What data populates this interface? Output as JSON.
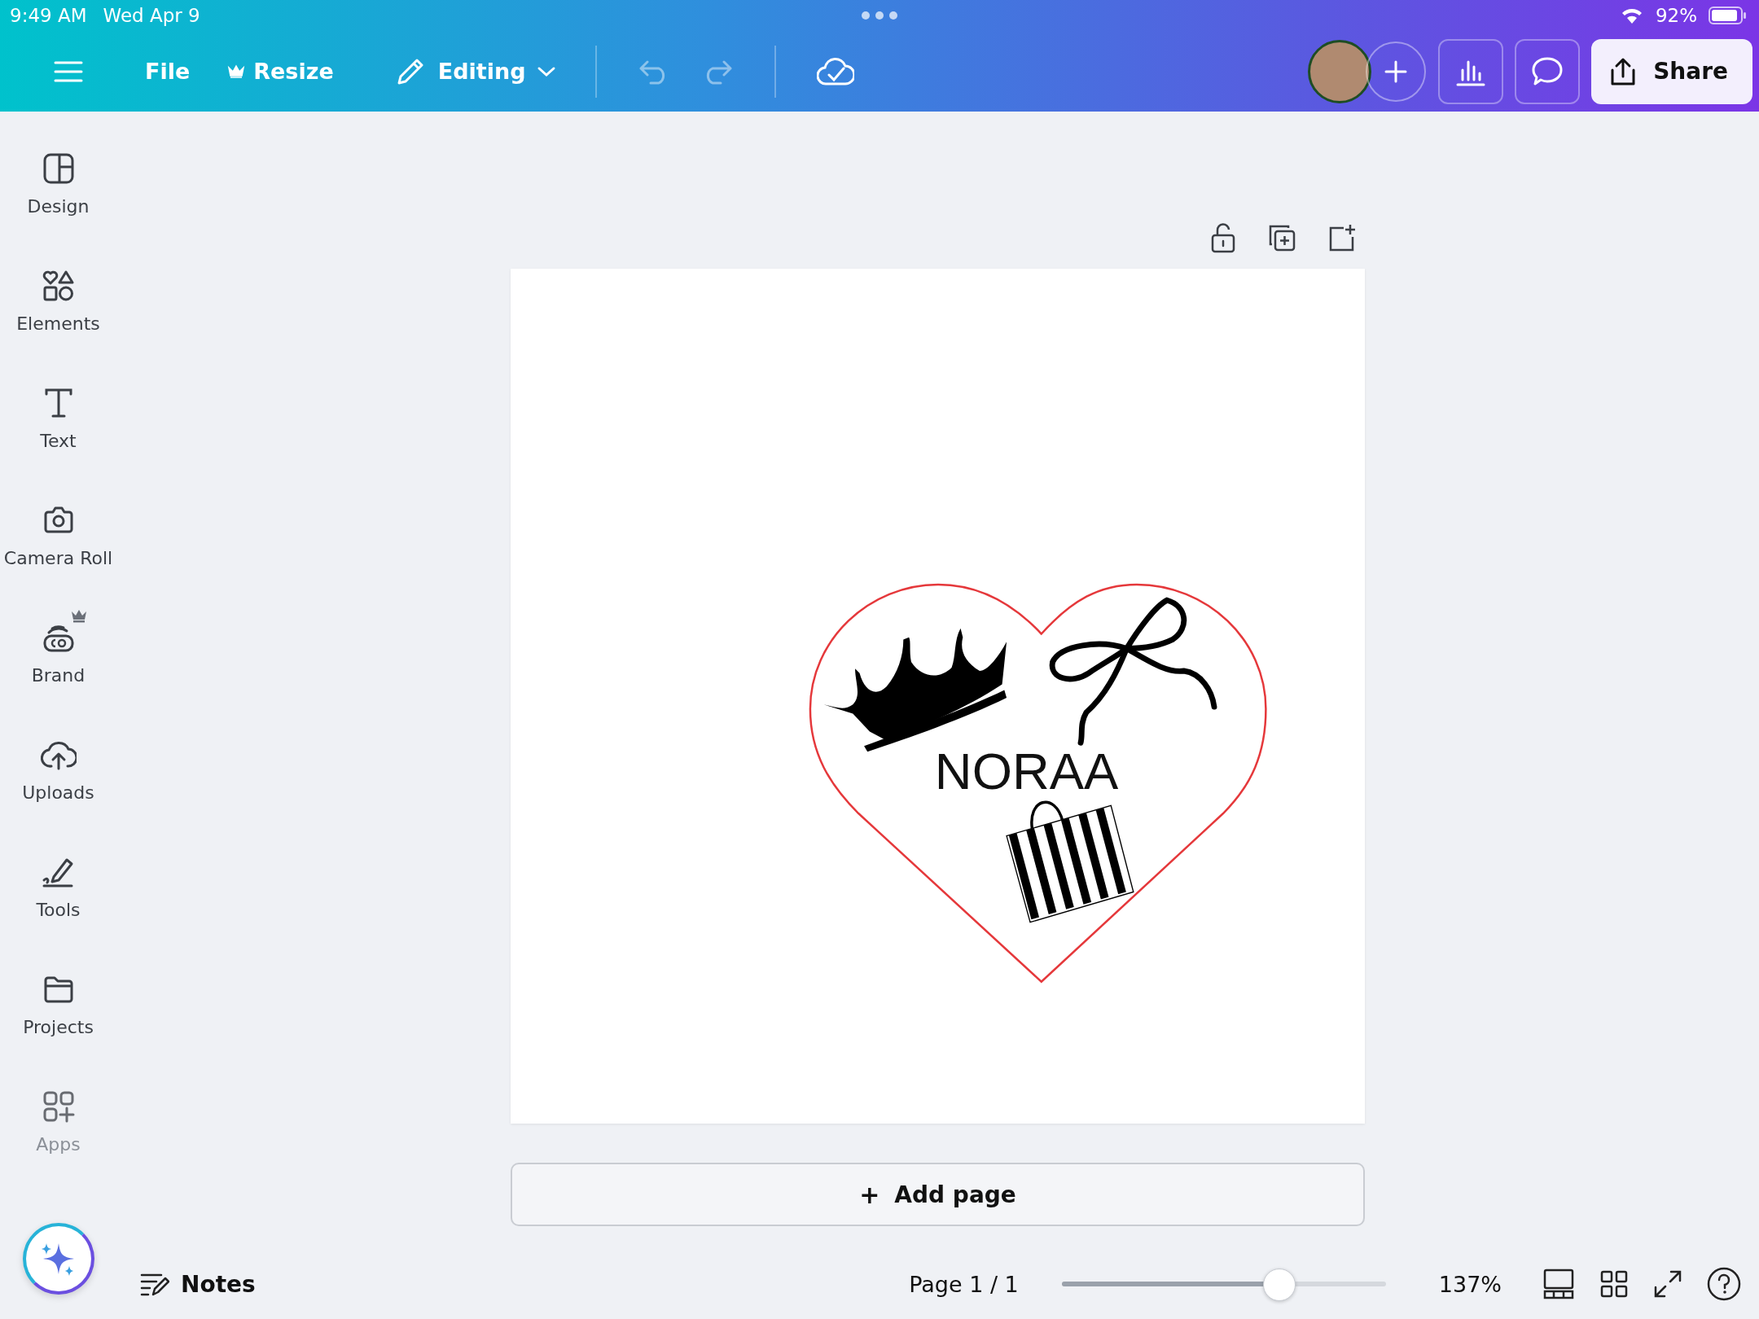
{
  "status_bar": {
    "time": "9:49 AM",
    "date": "Wed Apr 9",
    "battery": "92%"
  },
  "toolbar": {
    "file": "File",
    "resize": "Resize",
    "mode": "Editing",
    "undo_disabled": true,
    "redo_disabled": true,
    "share": "Share"
  },
  "sidebar": {
    "items": [
      {
        "label": "Design",
        "kind": "design",
        "premium": false,
        "disabled": false
      },
      {
        "label": "Elements",
        "kind": "elements",
        "premium": false,
        "disabled": false
      },
      {
        "label": "Text",
        "kind": "text",
        "premium": false,
        "disabled": false
      },
      {
        "label": "Camera Roll",
        "kind": "camera",
        "premium": false,
        "disabled": false
      },
      {
        "label": "Brand",
        "kind": "brand",
        "premium": true,
        "disabled": false
      },
      {
        "label": "Uploads",
        "kind": "uploads",
        "premium": false,
        "disabled": false
      },
      {
        "label": "Tools",
        "kind": "tools",
        "premium": false,
        "disabled": false
      },
      {
        "label": "Projects",
        "kind": "projects",
        "premium": false,
        "disabled": false
      },
      {
        "label": "Apps",
        "kind": "apps",
        "premium": false,
        "disabled": true
      }
    ]
  },
  "design": {
    "title": "NORAA"
  },
  "add_page": "Add page",
  "add_page_plus": "+",
  "bottom_bar": {
    "notes": "Notes",
    "page": "Page 1 / 1",
    "zoom": {
      "level": 0.65
    },
    "zoom_reading": "137%"
  }
}
